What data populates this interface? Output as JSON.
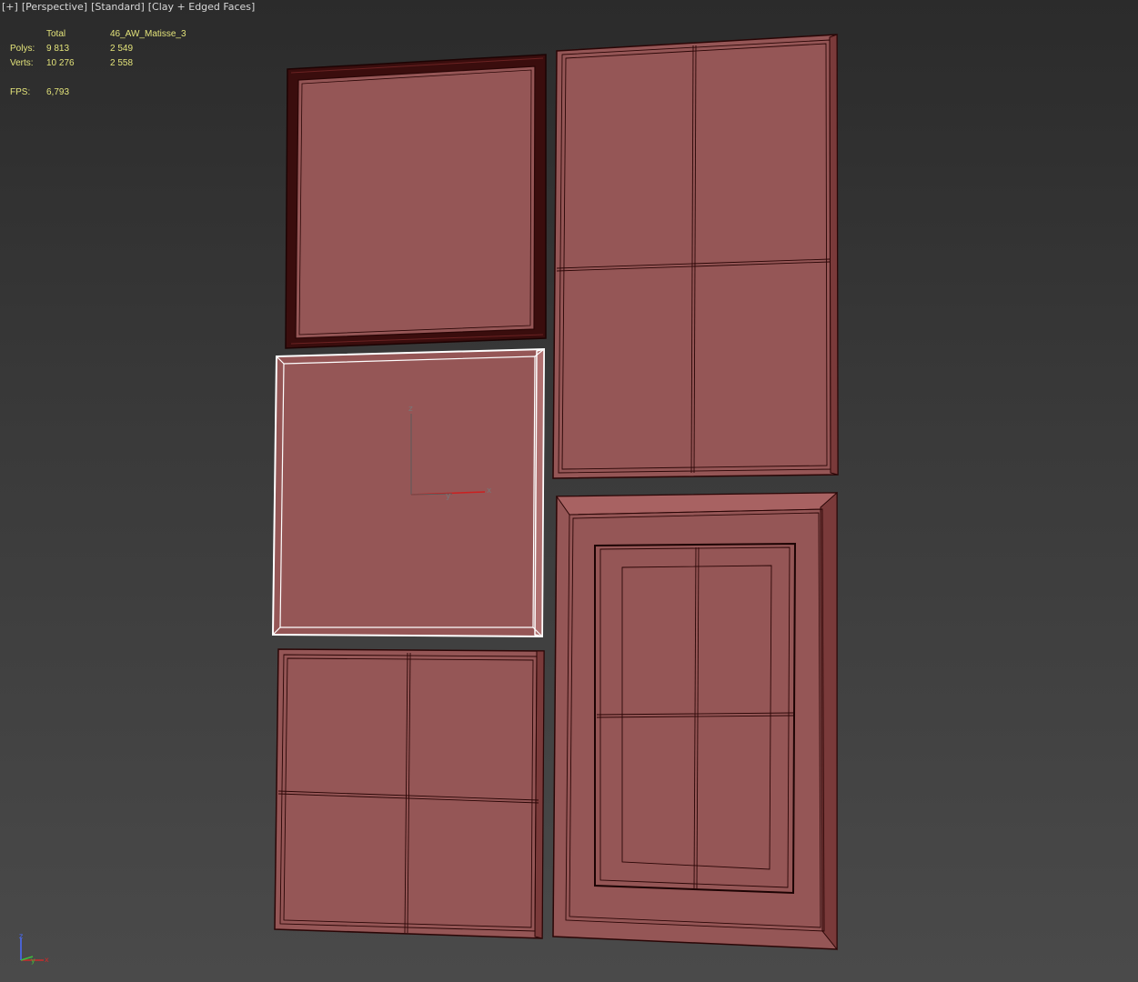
{
  "viewport": {
    "labels": [
      "[+]",
      "[Perspective]",
      "[Standard]",
      "[Clay + Edged Faces]"
    ]
  },
  "stats": {
    "header_total": "Total",
    "header_object": "46_AW_Matisse_3",
    "polys_label": "Polys:",
    "polys_total": "9 813",
    "polys_object": "2 549",
    "verts_label": "Verts:",
    "verts_total": "10 276",
    "verts_object": "2 558",
    "fps_label": "FPS:",
    "fps_value": "6,793"
  },
  "gizmo": {
    "z": "z",
    "x": "x",
    "y": "y"
  },
  "colors": {
    "clay": "#955656",
    "frame_dark": "#3a0d0d",
    "wire": "#2a0606",
    "selected_wire": "#ffffff",
    "stat_text": "#e3e37a"
  },
  "icons": [
    "axis-tripod-icon",
    "transform-gizmo-icon"
  ]
}
